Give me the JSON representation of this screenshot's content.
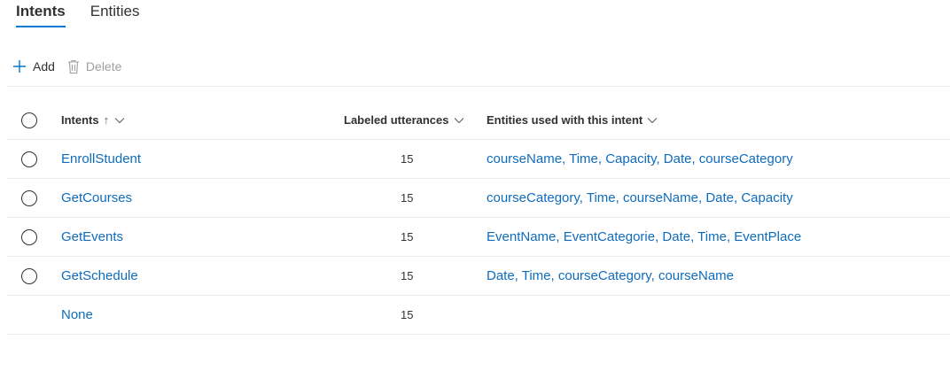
{
  "tabs": [
    {
      "label": "Intents",
      "active": true
    },
    {
      "label": "Entities",
      "active": false
    }
  ],
  "toolbar": {
    "add_label": "Add",
    "delete_label": "Delete"
  },
  "table": {
    "headers": {
      "intents": "Intents",
      "sort_arrow": "↑",
      "utterances": "Labeled utterances",
      "entities": "Entities used with this intent"
    },
    "rows": [
      {
        "intent": "EnrollStudent",
        "count": "15",
        "entities": "courseName, Time, Capacity, Date, courseCategory",
        "selectable": true
      },
      {
        "intent": "GetCourses",
        "count": "15",
        "entities": "courseCategory, Time, courseName, Date, Capacity",
        "selectable": true
      },
      {
        "intent": "GetEvents",
        "count": "15",
        "entities": "EventName, EventCategorie, Date, Time, EventPlace",
        "selectable": true
      },
      {
        "intent": "GetSchedule",
        "count": "15",
        "entities": "Date, Time, courseCategory, courseName",
        "selectable": true
      },
      {
        "intent": "None",
        "count": "15",
        "entities": "",
        "selectable": false
      }
    ]
  },
  "colors": {
    "accent": "#0078d4",
    "link": "#0f6cbd",
    "disabled": "#a19f9d",
    "divider": "#edebe9"
  }
}
